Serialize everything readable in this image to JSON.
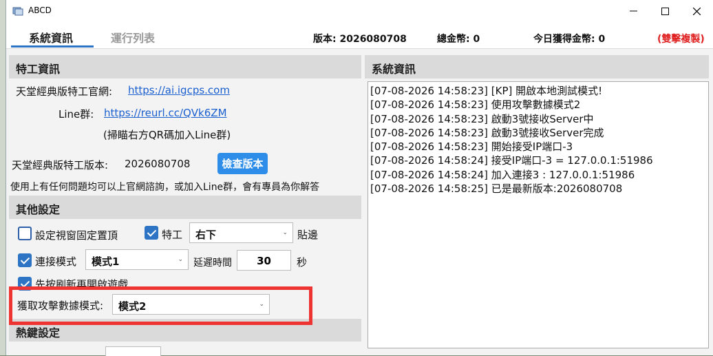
{
  "window": {
    "title": "ABCD",
    "minimize_icon": "minimize-icon",
    "maximize_icon": "maximize-icon",
    "close_icon": "close-icon"
  },
  "tabs": [
    {
      "label": "系統資訊"
    },
    {
      "label": "運行列表"
    }
  ],
  "stats": {
    "version": "版本: 2026080708",
    "total_coins": "總金幣:  0",
    "today_coins": "今日獲得金幣:  0",
    "dual_copy": "(雙擊複製)"
  },
  "agent_info": {
    "header": "特工資訊",
    "site_label": "天堂經典版特工官網:",
    "site_link": "https://ai.igcps.com",
    "line_label": "Line群:",
    "line_link": "https://reurl.cc/QVk6ZM",
    "qr_hint": "(掃瞄右方QR碼加入Line群)",
    "version_label": "天堂經典版特工版本:",
    "version_value": "2026080708",
    "check_button": "檢查版本",
    "help_text": "使用上有任何問題均可以上官網諮詢，或加入Line群，會有專員為你解答"
  },
  "other_settings": {
    "header": "其他設定",
    "pin_window": {
      "label": "設定視窗固定置頂",
      "checked": false
    },
    "agent": {
      "label": "特工",
      "checked": true,
      "position": "右下",
      "suffix": "貼邊"
    },
    "connect_mode": {
      "label": "連接模式",
      "checked": true,
      "value": "模式1",
      "delay_label": "延遲時間",
      "delay_value": "30",
      "unit": "秒"
    },
    "refresh_first": {
      "label": "先按刷新再開啟遊戲",
      "checked": true
    },
    "attack_mode": {
      "label": "獲取攻擊數據模式:",
      "value": "模式2"
    }
  },
  "hotkeys": {
    "header": "熱鍵設定"
  },
  "system_info": {
    "header": "系統資訊",
    "log": [
      "[07-08-2026 14:58:23] [KP] 開啟本地測試模式!",
      "[07-08-2026 14:58:23] 使用攻擊數據模式2",
      "[07-08-2026 14:58:23] 啟動3號接收Server中",
      "[07-08-2026 14:58:23] 啟動3號接收Server完成",
      "[07-08-2026 14:58:23] 開始接受IP端口-3",
      "[07-08-2026 14:58:24] 接受IP端口-3 =  127.0.0.1:51986",
      "[07-08-2026 14:58:24] 加入連接3 :  127.0.0.1:51986",
      "[07-08-2026 14:58:25] 已是最新版本:2026080708"
    ]
  },
  "colors": {
    "accent": "#2d74c4",
    "button": "#2d8de8",
    "link": "#1a5fd0",
    "highlight": "#ee3333",
    "warning_text": "#e02020"
  }
}
